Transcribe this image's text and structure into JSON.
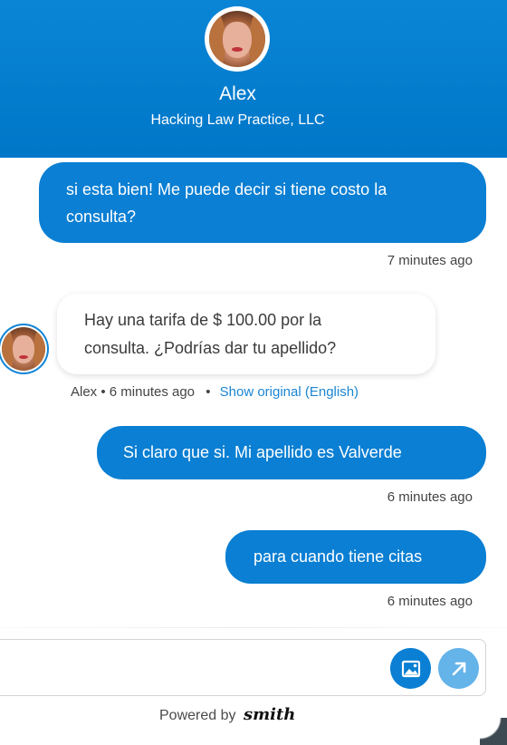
{
  "header": {
    "agent_name": "Alex",
    "company": "Hacking Law Practice, LLC"
  },
  "messages": [
    {
      "direction": "out",
      "line1": "si esta bien! Me puede decir si tiene costo la",
      "line2": "consulta?",
      "time": "7 minutes ago"
    },
    {
      "direction": "in",
      "line1": "Hay una tarifa de $ 100.00 por la",
      "line2": "consulta. ¿Podrías dar tu apellido?",
      "sender": "Alex",
      "time": "6 minutes ago",
      "separator": "•",
      "show_original": "Show original (English)"
    },
    {
      "direction": "out",
      "text": "Si claro que si. Mi apellido es Valverde",
      "time": "6 minutes ago"
    },
    {
      "direction": "out",
      "text": "para cuando tiene citas",
      "time": "6 minutes ago"
    }
  ],
  "composer": {
    "value": "",
    "placeholder": ""
  },
  "footer": {
    "powered_by": "Powered by",
    "brand": "smith"
  },
  "colors": {
    "header_bg": "#0a85d6",
    "outgoing_bubble": "#0a7fd3",
    "send_button": "#64b3e9",
    "link": "#1a86d4"
  },
  "icons": {
    "image_button": "image-icon",
    "send_button": "send-arrow-icon"
  }
}
